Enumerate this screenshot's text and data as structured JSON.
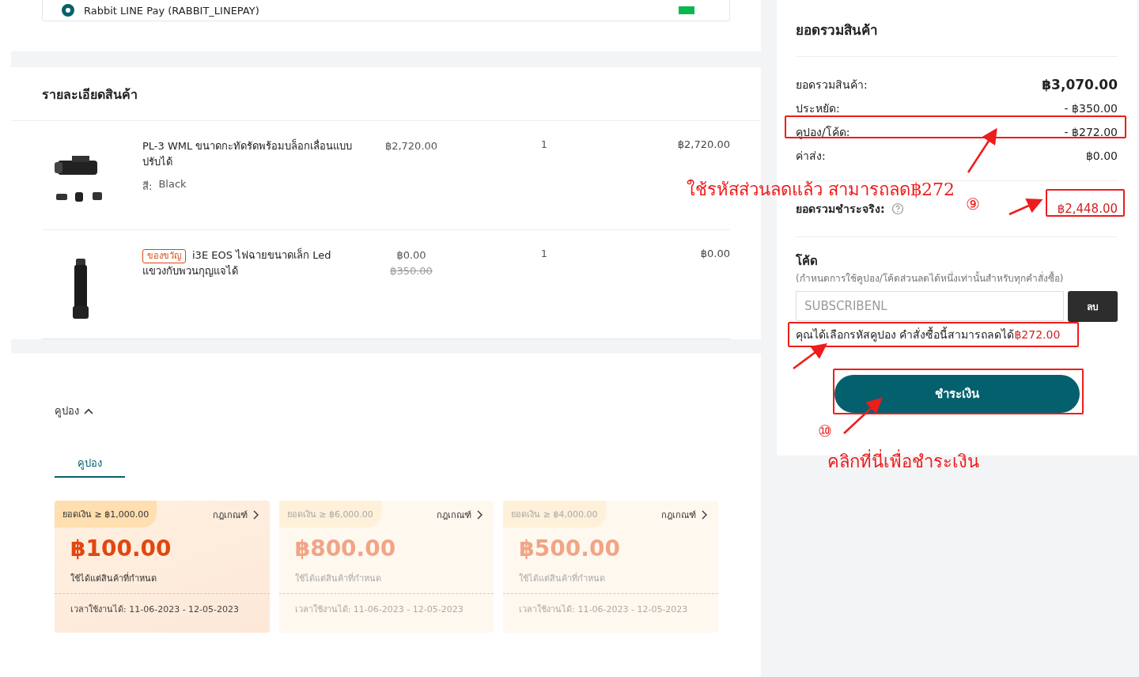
{
  "payment_option": {
    "label": "Rabbit LINE Pay (RABBIT_LINEPAY)",
    "selected": true
  },
  "product_section": {
    "title": "รายละเอียดสินค้า",
    "items": [
      {
        "name": "PL-3 WML ขนาดกะทัดรัดพร้อมบล็อกเลื่อนแบบปรับได้",
        "option_label": "สี:",
        "option_value": "Black",
        "price": "฿2,720.00",
        "quantity": "1",
        "subtotal": "฿2,720.00",
        "kind": "weapon-light"
      },
      {
        "tag": "ของขวัญ",
        "name": "i3E EOS ไฟฉายขนาดเล็ก Led แขวงกับพวนกุญแจได้",
        "price": "฿0.00",
        "original_price": "฿350.00",
        "quantity": "1",
        "subtotal": "฿0.00",
        "kind": "flashlight"
      }
    ]
  },
  "coupons": {
    "toggle_label": "คูปอง",
    "expanded": true,
    "tabs": [
      {
        "label": "คูปอง",
        "selected": true
      }
    ],
    "cards": [
      {
        "threshold": "ยอดเงิน ≥ ฿1,000.00",
        "rules_link": "กฎเกณฑ์",
        "amount": "฿100.00",
        "scope": "ใช้ได้แต่สินค้าที่กำหนด",
        "validity": "เวลาใช้งานได้: 11-06-2023 - 12-05-2023",
        "disabled": false
      },
      {
        "threshold": "ยอดเงิน ≥ ฿6,000.00",
        "rules_link": "กฎเกณฑ์",
        "amount": "฿800.00",
        "scope": "ใช้ได้แต่สินค้าที่กำหนด",
        "validity": "เวลาใช้งานได้: 11-06-2023 - 12-05-2023",
        "disabled": true
      },
      {
        "threshold": "ยอดเงิน ≥ ฿4,000.00",
        "rules_link": "กฎเกณฑ์",
        "amount": "฿500.00",
        "scope": "ใช้ได้แต่สินค้าที่กำหนด",
        "validity": "เวลาใช้งานได้: 11-06-2023 - 12-05-2023",
        "disabled": true
      }
    ]
  },
  "summary": {
    "title": "ยอดรวมสินค้า",
    "rows": [
      {
        "label": "ยอดรวมสินค้า:",
        "value": "฿3,070.00",
        "kind": "strong"
      },
      {
        "label": "ประหยัด:",
        "value": "- ฿350.00",
        "kind": "plain"
      },
      {
        "label": "คูปอง/โค้ด:",
        "value": "- ฿272.00",
        "kind": "plain"
      },
      {
        "label": "ค่าส่ง:",
        "value": "฿0.00",
        "kind": "plain"
      }
    ],
    "total_label": "ยอดรวมชำระจริง:",
    "total_value": "฿2,448.00",
    "code_title": "โค้ด",
    "code_note": "(กำหนดการใช้คูปอง/โค้ดส่วนลดได้หนึ่งเท่านั้นสำหรับทุกคำสั่งซื้อ)",
    "code_value": "SUBSCRIBENL",
    "remove_button": "ลบ",
    "applied_message": "คุณได้เลือกรหัสคูปอง คำสั่งซื้อนี้สามารถลดได้",
    "applied_amount": "฿272.00",
    "pay_button": "ชำระเงิน"
  },
  "annotations": [
    {
      "text": "ใช้รหัสส่วนลดแล้ว สามารถลด฿272"
    },
    {
      "text": "⑨"
    },
    {
      "text": "⑩"
    },
    {
      "text": "คลิกที่นี่เพื่อชำระเงิน"
    }
  ]
}
